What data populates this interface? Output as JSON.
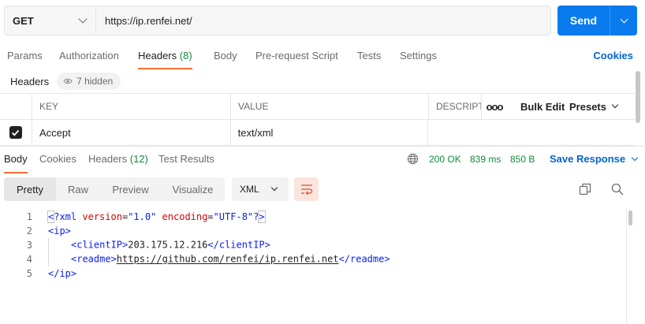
{
  "request": {
    "method": "GET",
    "url": "https://ip.renfei.net/",
    "send_label": "Send"
  },
  "request_tabs": [
    {
      "label": "Params"
    },
    {
      "label": "Authorization"
    },
    {
      "label": "Headers",
      "count": "(8)",
      "active": true
    },
    {
      "label": "Body"
    },
    {
      "label": "Pre-request Script"
    },
    {
      "label": "Tests"
    },
    {
      "label": "Settings"
    }
  ],
  "cookies_link": "Cookies",
  "headers_bar": {
    "title": "Headers",
    "hidden_label": "7 hidden"
  },
  "headers_table": {
    "columns": {
      "key": "KEY",
      "value": "VALUE",
      "description": "DESCRIPTION",
      "more": "ooo",
      "bulk_edit": "Bulk Edit",
      "presets": "Presets"
    },
    "rows": [
      {
        "checked": true,
        "key": "Accept",
        "value": "text/xml",
        "description": ""
      }
    ]
  },
  "response_tabs": [
    {
      "label": "Body",
      "active": true
    },
    {
      "label": "Cookies"
    },
    {
      "label": "Headers",
      "count": "(12)"
    },
    {
      "label": "Test Results"
    }
  ],
  "response_meta": {
    "status": "200 OK",
    "time": "839 ms",
    "size": "850 B",
    "save_label": "Save Response"
  },
  "view_modes": [
    "Pretty",
    "Raw",
    "Preview",
    "Visualize"
  ],
  "active_view": "Pretty",
  "format": "XML",
  "code_lines": [
    "1",
    "2",
    "3",
    "4",
    "5"
  ],
  "xml": {
    "version": "\"1.0\"",
    "encoding": "\"UTF-8\"",
    "client_ip": "203.175.12.216",
    "readme": "https://github.com/renfei/ip.renfei.net"
  },
  "colors": {
    "accent": "#ff6c37",
    "primary": "#097bed",
    "success": "#0f8d3a",
    "link": "#0265d2"
  }
}
